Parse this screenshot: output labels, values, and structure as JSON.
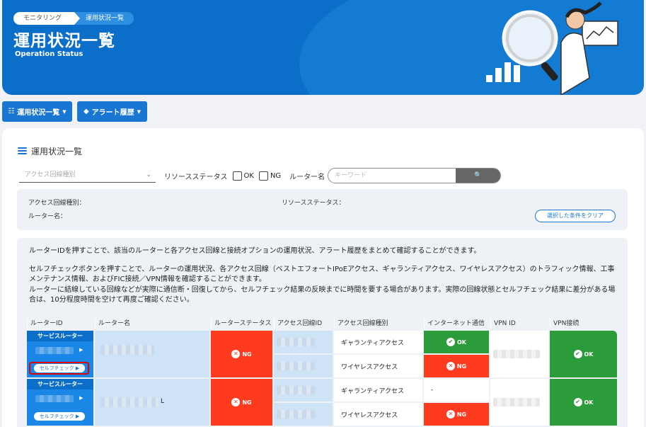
{
  "breadcrumb": [
    "モニタリング",
    "運用状況一覧"
  ],
  "header": {
    "title": "運用状況一覧",
    "subtitle": "Operation Status"
  },
  "menu": {
    "status_btn": "運用状況一覧",
    "alert_btn": "アラート履歴"
  },
  "section": {
    "title": "運用状況一覧"
  },
  "filters": {
    "access_type_placeholder": "アクセス回線種別",
    "resource_status_label": "リソースステータス",
    "ok_label": "OK",
    "ng_label": "NG",
    "router_name_label": "ルーター名",
    "keyword_placeholder": "キーワード"
  },
  "conditions": {
    "access_type": "アクセス回線種別：",
    "resource_status": "リソースステータス：",
    "router_name": "ルーター名：",
    "clear_btn": "選択した条件をクリア"
  },
  "info": {
    "p1": "ルーターIDを押すことで、該当のルーターと各アクセス回線と接続オプションの運用状況、アラート履歴をまとめて確認することができます。",
    "p2": "セルフチェックボタンを押すことで、ルーターの運用状況、各アクセス回線（ベストエフォートIPoEアクセス、ギャランティアクセス、ワイヤレスアクセス）のトラフィック情報、工事メンテナンス情報、およびFIC接続／VPN情報を確認することができます。",
    "p3": "ルーターに結線している回線などが実際に通信断・回復してから、セルフチェック結果の反映までに時間を要する場合があります。実際の回線状態とセルフチェック結果に差分がある場合は、10分程度時間を空けて再度ご確認ください。"
  },
  "table": {
    "headers": [
      "ルーターID",
      "ルーター名",
      "ルーターステータス",
      "アクセス回線ID",
      "アクセス回線種別",
      "インターネット通信",
      "VPN ID",
      "VPN接続"
    ],
    "rows": [
      {
        "type_label": "サービスルーター",
        "self_check": "セルフチェック",
        "router_status": "NG",
        "lines": [
          {
            "kind": "ギャランティアクセス",
            "internet": "OK"
          },
          {
            "kind": "ワイヤレスアクセス",
            "internet": "NG"
          }
        ],
        "vpn": "OK"
      },
      {
        "type_label": "サービスルーター",
        "self_check": "セルフチェック",
        "router_name_suffix": "L",
        "router_status": "NG",
        "lines": [
          {
            "kind": "ギャランティアクセス",
            "internet": "-"
          },
          {
            "kind": "ワイヤレスアクセス",
            "internet": "NG"
          }
        ],
        "vpn": "OK"
      }
    ]
  }
}
